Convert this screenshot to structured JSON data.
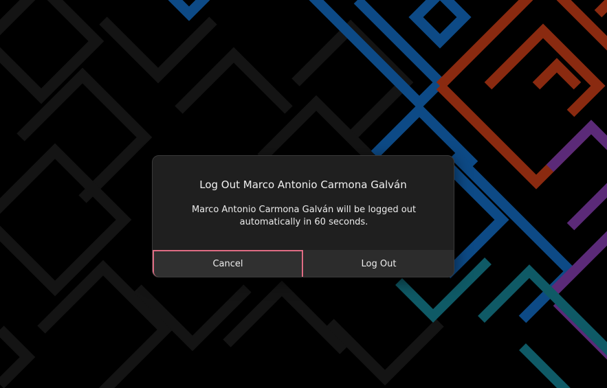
{
  "dialog": {
    "title": "Log Out Marco Antonio Carmona Galván",
    "message_line1": "Marco Antonio Carmona Galván will be logged out",
    "message_line2": "automatically in 60 seconds.",
    "cancel_label": "Cancel",
    "logout_label": "Log Out"
  },
  "colors": {
    "focus_ring": "#e06c84",
    "wallpaper_blue": "#0d4a86",
    "wallpaper_red": "#8a2a10",
    "wallpaper_purple": "#5b2a78",
    "wallpaper_teal": "#0f5a66",
    "wallpaper_gray": "#141414"
  }
}
